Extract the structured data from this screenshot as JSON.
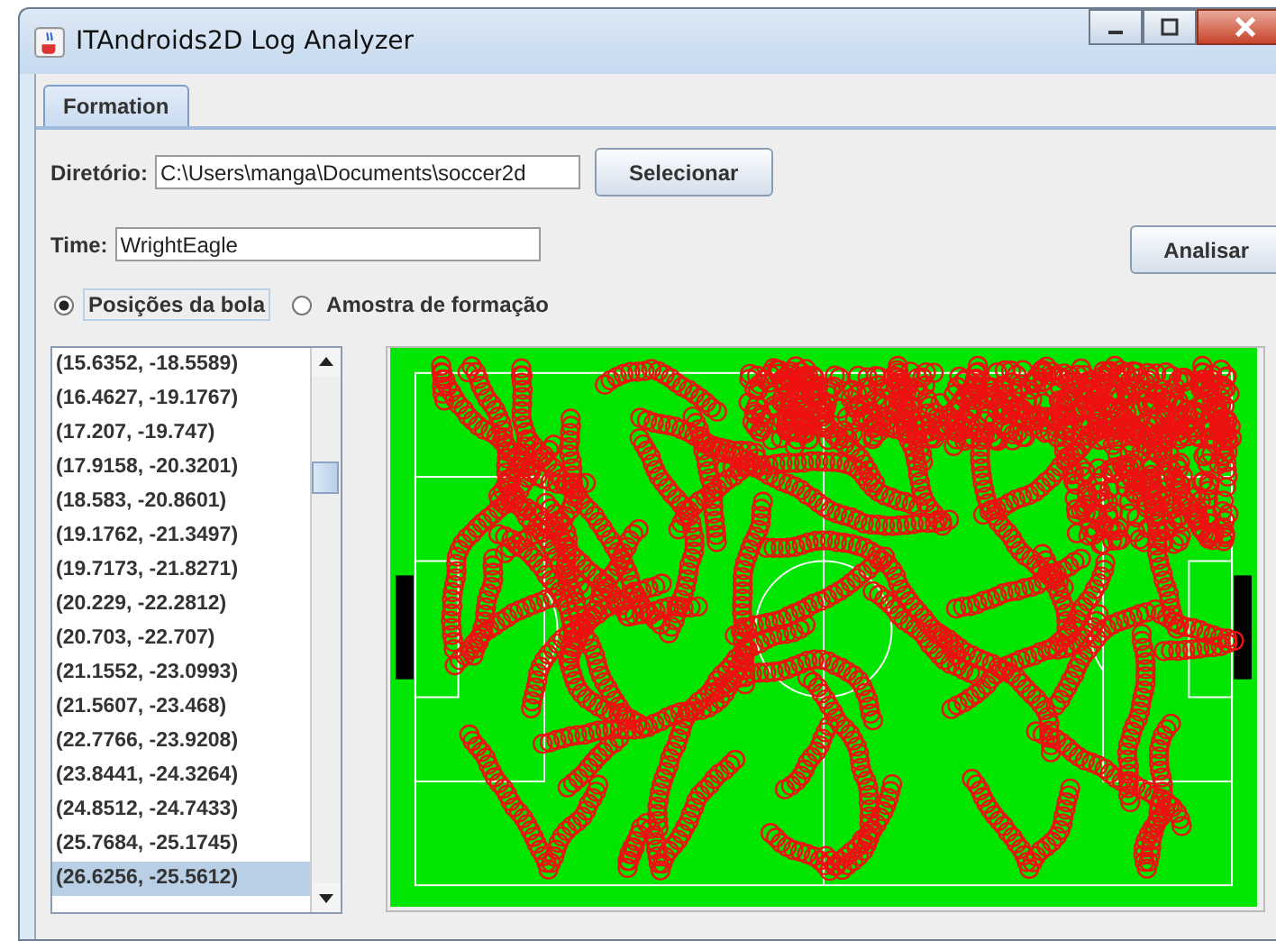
{
  "window": {
    "title": "ITAndroids2D Log Analyzer"
  },
  "tabs": [
    {
      "label": "Formation",
      "selected": true
    }
  ],
  "directory": {
    "label": "Diretório:",
    "value": "C:\\Users\\manga\\Documents\\soccer2d",
    "button": "Selecionar"
  },
  "team": {
    "label": "Time:",
    "value": "WrightEagle"
  },
  "analyze_button": "Analisar",
  "radios": [
    {
      "label": "Posições da bola",
      "selected": true
    },
    {
      "label": "Amostra de formação",
      "selected": false
    }
  ],
  "positions": [
    {
      "text": "(15.6352, -18.5589)",
      "selected": false
    },
    {
      "text": "(16.4627, -19.1767)",
      "selected": false
    },
    {
      "text": "(17.207, -19.747)",
      "selected": false
    },
    {
      "text": "(17.9158, -20.3201)",
      "selected": false
    },
    {
      "text": "(18.583, -20.8601)",
      "selected": false
    },
    {
      "text": "(19.1762, -21.3497)",
      "selected": false
    },
    {
      "text": "(19.7173, -21.8271)",
      "selected": false
    },
    {
      "text": "(20.229, -22.2812)",
      "selected": false
    },
    {
      "text": "(20.703, -22.707)",
      "selected": false
    },
    {
      "text": "(21.1552, -23.0993)",
      "selected": false
    },
    {
      "text": "(21.5607, -23.468)",
      "selected": false
    },
    {
      "text": "(22.7766, -23.9208)",
      "selected": false
    },
    {
      "text": "(23.8441, -24.3264)",
      "selected": false
    },
    {
      "text": "(24.8512, -24.7433)",
      "selected": false
    },
    {
      "text": "(25.7684, -25.1745)",
      "selected": false
    },
    {
      "text": "(26.6256, -25.5612)",
      "selected": true
    }
  ]
}
